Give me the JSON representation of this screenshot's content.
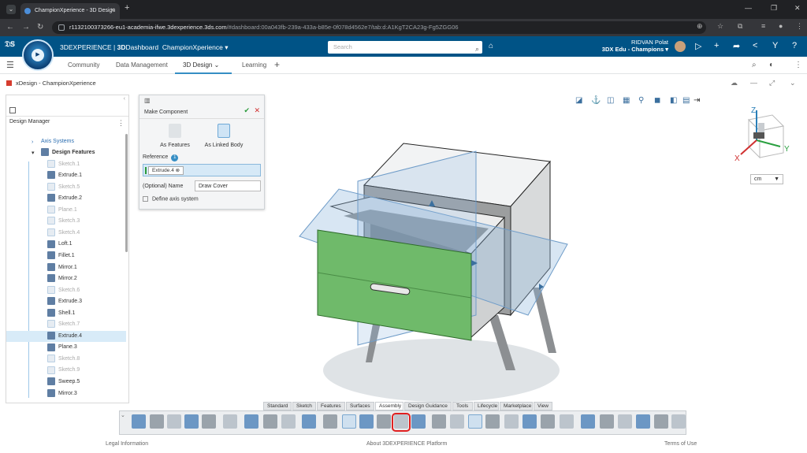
{
  "browser": {
    "tab_title": "ChampionXperience - 3D Design",
    "url_host": "r1132100373266-eu1-academia-ifwe.3dexperience.3ds.com",
    "url_rest": "/#dashboard:00a043fb-239a-433a-b85e-0f078d4562e7/tab:d:A1KgT2CA23g-Fg5ZGG06"
  },
  "header": {
    "brand_pre": "3D",
    "brand_main": "EXPERIENCE",
    "brand_sep": " | ",
    "dashboard_bold": "3D",
    "dashboard": "Dashboard",
    "dashboard_name": "ChampionXperience ▾",
    "search_placeholder": "Search",
    "user_name": "RIDVAN Polat",
    "user_org": "3DX Edu - Champions ▾",
    "compass_label": "V,R"
  },
  "app_tabs": [
    {
      "label": "Community"
    },
    {
      "label": "Data Management"
    },
    {
      "label": "3D Design"
    },
    {
      "label": "Learning"
    }
  ],
  "app": {
    "title": "xDesign - ChampionXperience"
  },
  "tree": {
    "title": "Design Manager",
    "items": [
      {
        "label": "Axis Systems",
        "dim": false
      },
      {
        "label": "Design Features",
        "dim": false
      },
      {
        "label": "Sketch.1",
        "dim": true
      },
      {
        "label": "Extrude.1",
        "dim": false
      },
      {
        "label": "Sketch.5",
        "dim": true
      },
      {
        "label": "Extrude.2",
        "dim": false
      },
      {
        "label": "Plane.1",
        "dim": true
      },
      {
        "label": "Sketch.3",
        "dim": true
      },
      {
        "label": "Sketch.4",
        "dim": true
      },
      {
        "label": "Loft.1",
        "dim": false
      },
      {
        "label": "Fillet.1",
        "dim": false
      },
      {
        "label": "Mirror.1",
        "dim": false
      },
      {
        "label": "Mirror.2",
        "dim": false
      },
      {
        "label": "Sketch.6",
        "dim": true
      },
      {
        "label": "Extrude.3",
        "dim": false
      },
      {
        "label": "Shell.1",
        "dim": false
      },
      {
        "label": "Sketch.7",
        "dim": true
      },
      {
        "label": "Extrude.4",
        "dim": false
      },
      {
        "label": "Plane.3",
        "dim": false
      },
      {
        "label": "Sketch.8",
        "dim": true
      },
      {
        "label": "Sketch.9",
        "dim": true
      },
      {
        "label": "Sweep.5",
        "dim": false
      },
      {
        "label": "Mirror.3",
        "dim": false
      }
    ]
  },
  "panel": {
    "title": "Make Component",
    "opt_features": "As Features",
    "opt_linked": "As Linked Body",
    "reference_label": "Reference",
    "reference_count": "1",
    "reference_chip": "Extrude.4",
    "name_label": "(Optional) Name",
    "name_value": "Draw Cover",
    "define_axis": "Define axis system"
  },
  "viewport": {
    "units": "cm",
    "axis_x": "X",
    "axis_y": "Y",
    "axis_z": "Z"
  },
  "toolbar_tabs": [
    {
      "label": "Standard"
    },
    {
      "label": "Sketch"
    },
    {
      "label": "Features"
    },
    {
      "label": "Surfaces"
    },
    {
      "label": "Assembly"
    },
    {
      "label": "Design Guidance"
    },
    {
      "label": "Tools"
    },
    {
      "label": "Lifecycle"
    },
    {
      "label": "Marketplace"
    },
    {
      "label": "View"
    }
  ],
  "footer": {
    "legal": "Legal Information",
    "about": "About 3DEXPERIENCE Platform",
    "terms": "Terms of Use"
  },
  "colors": {
    "header_blue": "#005386",
    "accent": "#368ec4",
    "drawer_green": "#6fba6a",
    "highlight_red": "#e02020"
  }
}
